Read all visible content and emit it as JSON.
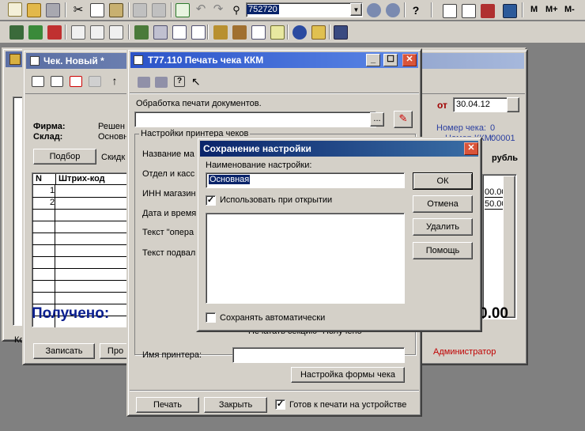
{
  "toolbar": {
    "search_value": "752720",
    "mem_buttons": [
      "M",
      "M+",
      "M-"
    ]
  },
  "check_window": {
    "title": "Чек. Новый *",
    "firm_label": "Фирма:",
    "firm_value": "Решен",
    "warehouse_label": "Склад:",
    "warehouse_value": "Основн",
    "select_button": "Подбор",
    "discount_label": "Скидк",
    "table_headers": [
      "N",
      "Штрих-код"
    ],
    "rows": [
      "1",
      "2"
    ],
    "received_label": "Получено:",
    "save_button": "Записать",
    "post_button": "Про",
    "cut_label": "Ко"
  },
  "right_panel": {
    "date_label": "от",
    "date_value": "30.04.12",
    "check_number_label": "Номер чека:",
    "check_number_value": "0",
    "kkm_label": "Номер ККМ:",
    "kkm_value": "00001",
    "currency": "рубль",
    "amount1": "00.00",
    "amount2": "50.00",
    "total": "0.00",
    "user": "Администратор"
  },
  "print_window": {
    "title": "Т77.110 Печать чека ККМ",
    "processing_label": "Обработка печати документов.",
    "browse_button": "...",
    "printer_settings_label": "Настройки принтера чеков",
    "labels": [
      "Название ма",
      "Отдел и касс",
      "ИНН магазин",
      "Дата и время",
      "Текст \"опера",
      "Текст подвал"
    ],
    "print_section_label": "Печатать секцию \"Получено\"",
    "printer_name_label": "Имя принтера:",
    "form_settings_button": "Настройка формы чека",
    "print_button": "Печать",
    "close_button": "Закрыть",
    "ready_label": "Готов к печати на устройстве"
  },
  "save_dialog": {
    "title": "Сохранение настройки",
    "name_label": "Наименование настройки:",
    "name_value": "Основная",
    "use_on_open_label": "Использовать при открытии",
    "autosave_label": "Сохранять автоматически",
    "ok_button": "ОК",
    "cancel_button": "Отмена",
    "delete_button": "Удалить",
    "help_button": "Помощь"
  },
  "colors": {
    "title_active": "#0a246a",
    "title_blue": "#2b53c8",
    "received": "#0a1f8f",
    "user": "#c00000",
    "chevron_red": "#cc0000"
  }
}
